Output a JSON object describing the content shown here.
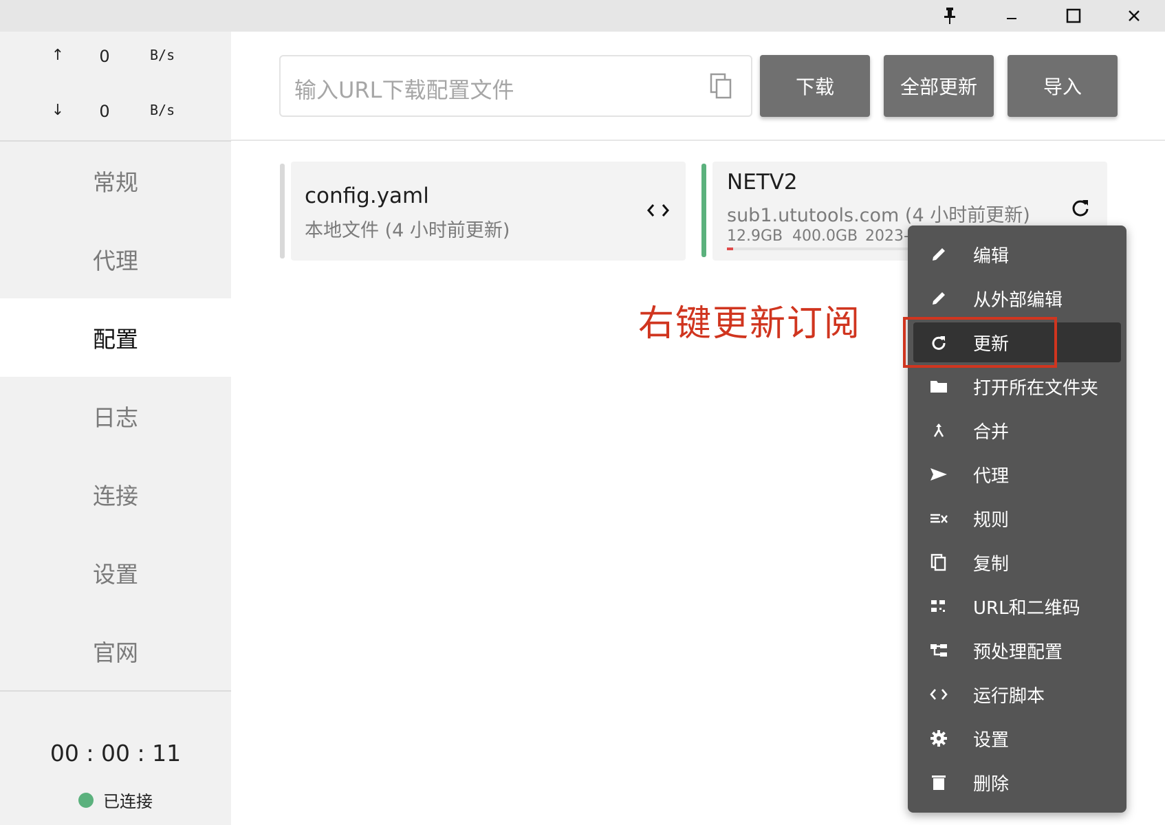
{
  "window": {
    "controls": {
      "pin": "🖈",
      "minimize": "–",
      "maximize": "☐",
      "close": "✕"
    }
  },
  "sidebar": {
    "traffic": {
      "up": {
        "arrow": "↑",
        "value": "0",
        "unit": "B/s"
      },
      "down": {
        "arrow": "↓",
        "value": "0",
        "unit": "B/s"
      }
    },
    "nav": [
      {
        "label": "常规"
      },
      {
        "label": "代理"
      },
      {
        "label": "配置"
      },
      {
        "label": "日志"
      },
      {
        "label": "连接"
      },
      {
        "label": "设置"
      },
      {
        "label": "官网"
      }
    ],
    "active_index": 2,
    "uptime": "00 : 00 : 11",
    "status_label": "已连接",
    "status_color": "#5bb17d"
  },
  "toolbar": {
    "url_placeholder": "输入URL下载配置文件",
    "download_label": "下载",
    "update_all_label": "全部更新",
    "import_label": "导入"
  },
  "profiles": [
    {
      "name": "config.yaml",
      "subtitle": "本地文件 (4 小时前更新)",
      "active": false,
      "accent": "#d9d9d9"
    },
    {
      "name": "NETV2",
      "subtitle": "sub1.ututools.com (4 小时前更新)",
      "used": "12.9GB",
      "total": "400.0GB",
      "expire": "2023-",
      "usage_fraction": 0.032,
      "active": true,
      "accent": "#5bb17d"
    }
  ],
  "annotation": {
    "text": "右键更新订阅",
    "color": "#d0351f"
  },
  "context_menu": {
    "items": [
      {
        "icon": "pencil-icon",
        "label": "编辑"
      },
      {
        "icon": "pencil-icon",
        "label": "从外部编辑"
      },
      {
        "icon": "refresh-icon",
        "label": "更新"
      },
      {
        "icon": "folder-icon",
        "label": "打开所在文件夹"
      },
      {
        "icon": "merge-icon",
        "label": "合并"
      },
      {
        "icon": "send-icon",
        "label": "代理"
      },
      {
        "icon": "rules-icon",
        "label": "规则"
      },
      {
        "icon": "copy-icon",
        "label": "复制"
      },
      {
        "icon": "qrcode-icon",
        "label": "URL和二维码"
      },
      {
        "icon": "tree-icon",
        "label": "预处理配置"
      },
      {
        "icon": "code-icon",
        "label": "运行脚本"
      },
      {
        "icon": "gear-icon",
        "label": "设置"
      },
      {
        "icon": "trash-icon",
        "label": "删除"
      }
    ],
    "hover_index": 2
  }
}
